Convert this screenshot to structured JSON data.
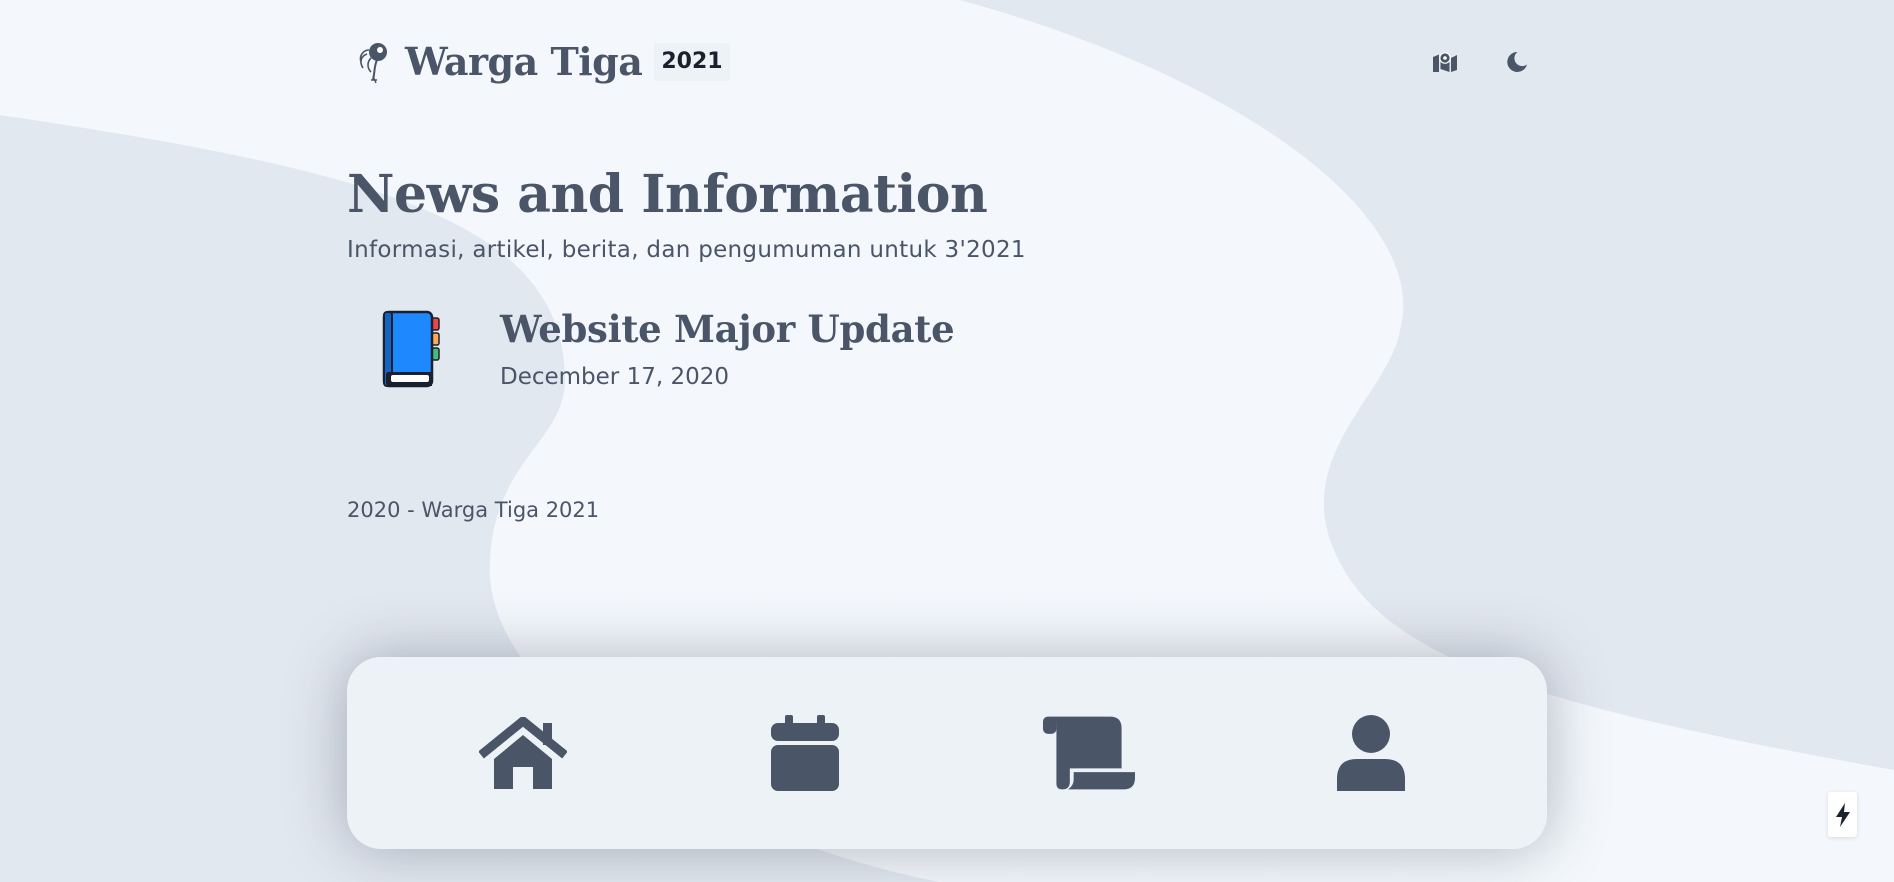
{
  "brand": {
    "name": "Warga Tiga",
    "year": "2021"
  },
  "header": {
    "map_button_icon": "map-location-icon",
    "theme_button_icon": "moon-icon"
  },
  "main": {
    "title": "News and Information",
    "subtitle": "Informasi, artikel, berita, dan pengumuman untuk 3'2021",
    "posts": [
      {
        "icon": "book-icon",
        "title": "Website Major Update",
        "date": "December 17, 2020"
      }
    ]
  },
  "footer": {
    "text": "2020 - Warga Tiga 2021"
  },
  "bottom_nav": {
    "items": [
      {
        "icon": "home-icon"
      },
      {
        "icon": "calendar-icon"
      },
      {
        "icon": "scroll-icon"
      },
      {
        "icon": "user-icon"
      }
    ]
  },
  "badge": {
    "icon": "bolt-icon"
  },
  "colors": {
    "page_background": "#e2e8f0",
    "blob_background": "#f4f8fc",
    "text": "#4a5568",
    "nav_background": "#edf2f7",
    "book_blue": "#1e88ff"
  }
}
